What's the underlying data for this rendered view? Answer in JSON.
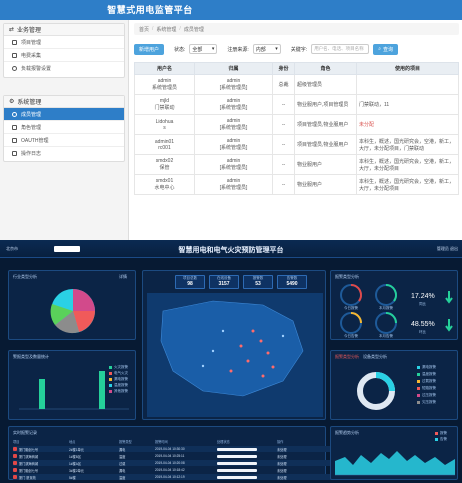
{
  "top": {
    "title": "智慧式用电监管平台",
    "sidebar": {
      "group1": {
        "label": "业务管理",
        "items": [
          "项目管理",
          "电费采集",
          "负载报警设置"
        ]
      },
      "group2": {
        "label": "系统管理",
        "items": [
          "成员管理",
          "角色管理",
          "OAUTH管理",
          "操作日志"
        ],
        "active_index": 0
      }
    },
    "breadcrumb": [
      "首页",
      "系统管理",
      "成员管理"
    ],
    "toolbar": {
      "add_button": "新增用户",
      "status_label": "状态:",
      "status_value": "全部",
      "source_label": "注册来源:",
      "source_value": "内部",
      "keyword_label": "关键字:",
      "keyword_placeholder": "用户名、电话、项目名称",
      "search_button": "查询"
    },
    "table": {
      "headers": [
        "用户名",
        "归属",
        "身份",
        "角色",
        "使用的项目"
      ],
      "rows": [
        {
          "name1": "admin",
          "name2": "系统管理员",
          "owner1": "admin",
          "owner2": "[系统管理员]",
          "identity": "总裁",
          "role": "超级管理员",
          "project": "",
          "project_style": "gray"
        },
        {
          "name1": "mjld",
          "name2": "门禁联动",
          "owner1": "admin",
          "owner2": "[系统管理员]",
          "identity": "--",
          "role": "物业服用户,项目管理员",
          "project": "门禁联动，11",
          "project_style": "normal"
        },
        {
          "name1": "Lidohua",
          "name2": "s",
          "owner1": "admin",
          "owner2": "[系统管理员]",
          "identity": "--",
          "role": "项目管理员,物业服用户",
          "project": "未分配",
          "project_style": "red"
        },
        {
          "name1": "admin01",
          "name2": "rc001",
          "owner1": "admin",
          "owner2": "[系统管理员]",
          "identity": "--",
          "role": "项目管理员,物业服用户",
          "project": "本科生，概述，国光研究会，空港，新工，大厅，未分配项目，门禁联动",
          "project_style": "normal"
        },
        {
          "name1": "smdx02",
          "name2": "保管",
          "owner1": "admin",
          "owner2": "[系统管理员]",
          "identity": "--",
          "role": "物业服用户",
          "project": "本科生，概述，国光研究会，空港，新工，大厅，未分配项目",
          "project_style": "normal"
        },
        {
          "name1": "smdx01",
          "name2": "水电中心",
          "owner1": "admin",
          "owner2": "[系统管理员]",
          "identity": "--",
          "role": "物业服用户",
          "project": "本科生，概述，国光研究会，空港，新工，大厅，未分配项目",
          "project_style": "normal"
        }
      ]
    }
  },
  "bottom": {
    "title": "智慧用电和电气火灾预防管理平台",
    "user_text": "管理员  退出",
    "location_text": "北京市",
    "panels": {
      "type_stats": "行业类型分析",
      "type_stats_more": "详情",
      "device_stats": "警报类型及数量统计",
      "map": "",
      "alarm_stats": "报警类型分析",
      "realtime": "实时报警记录",
      "trend": "报警趋势分析"
    },
    "stat_boxes": [
      {
        "label": "项目总数",
        "value": "98"
      },
      {
        "label": "在线设备",
        "value": "3157"
      },
      {
        "label": "报警数",
        "value": "53"
      },
      {
        "label": "告警数",
        "value": "5490"
      }
    ],
    "percentages": [
      {
        "value": "17.24%",
        "label": "同比"
      },
      {
        "value": "48.55%",
        "label": "环比"
      }
    ],
    "gauges": [
      "今日报警",
      "本月报警",
      "今日告警",
      "本月告警"
    ],
    "pie_colors": [
      "#2ad1e5",
      "#d24a8b",
      "#8c8c8c",
      "#f05a5a",
      "#5ad15a"
    ],
    "bar_legend": [
      "火灾报警",
      "电气火灾",
      "漏电报警",
      "温度报警",
      "其他报警"
    ],
    "ring_legend": [
      "漏电报警",
      "温度报警",
      "过载报警",
      "短路报警",
      "过压报警",
      "欠压报警"
    ],
    "tab_labels": [
      "报警类型分析",
      "设备类型分析"
    ],
    "realtime_headers": [
      "项目",
      "地点",
      "报警类型",
      "报警时间",
      "处理状态",
      "操作"
    ],
    "realtime_rows": [
      {
        "project": "厦门融创七号",
        "place": "2#楼1单元",
        "type": "漏电",
        "time": "2019-04-04 10:30:30",
        "status": "未处理"
      },
      {
        "project": "厦门滨海商城",
        "place": "1#楼B区",
        "type": "温度",
        "time": "2019-04-04 10:25:11",
        "status": "未处理"
      },
      {
        "project": "厦门滨海商城",
        "place": "1#楼A区",
        "type": "过载",
        "time": "2019-04-04 10:20:08",
        "status": "未处理"
      },
      {
        "project": "厦门融创七号",
        "place": "3#楼2单元",
        "type": "漏电",
        "time": "2019-04-04 10:18:42",
        "status": "未处理"
      },
      {
        "project": "厦门 厦景苑",
        "place": "5#楼",
        "type": "温度",
        "time": "2019-04-04 10:12:19",
        "status": "未处理"
      }
    ],
    "trend_legend": [
      "报警",
      "告警"
    ]
  }
}
